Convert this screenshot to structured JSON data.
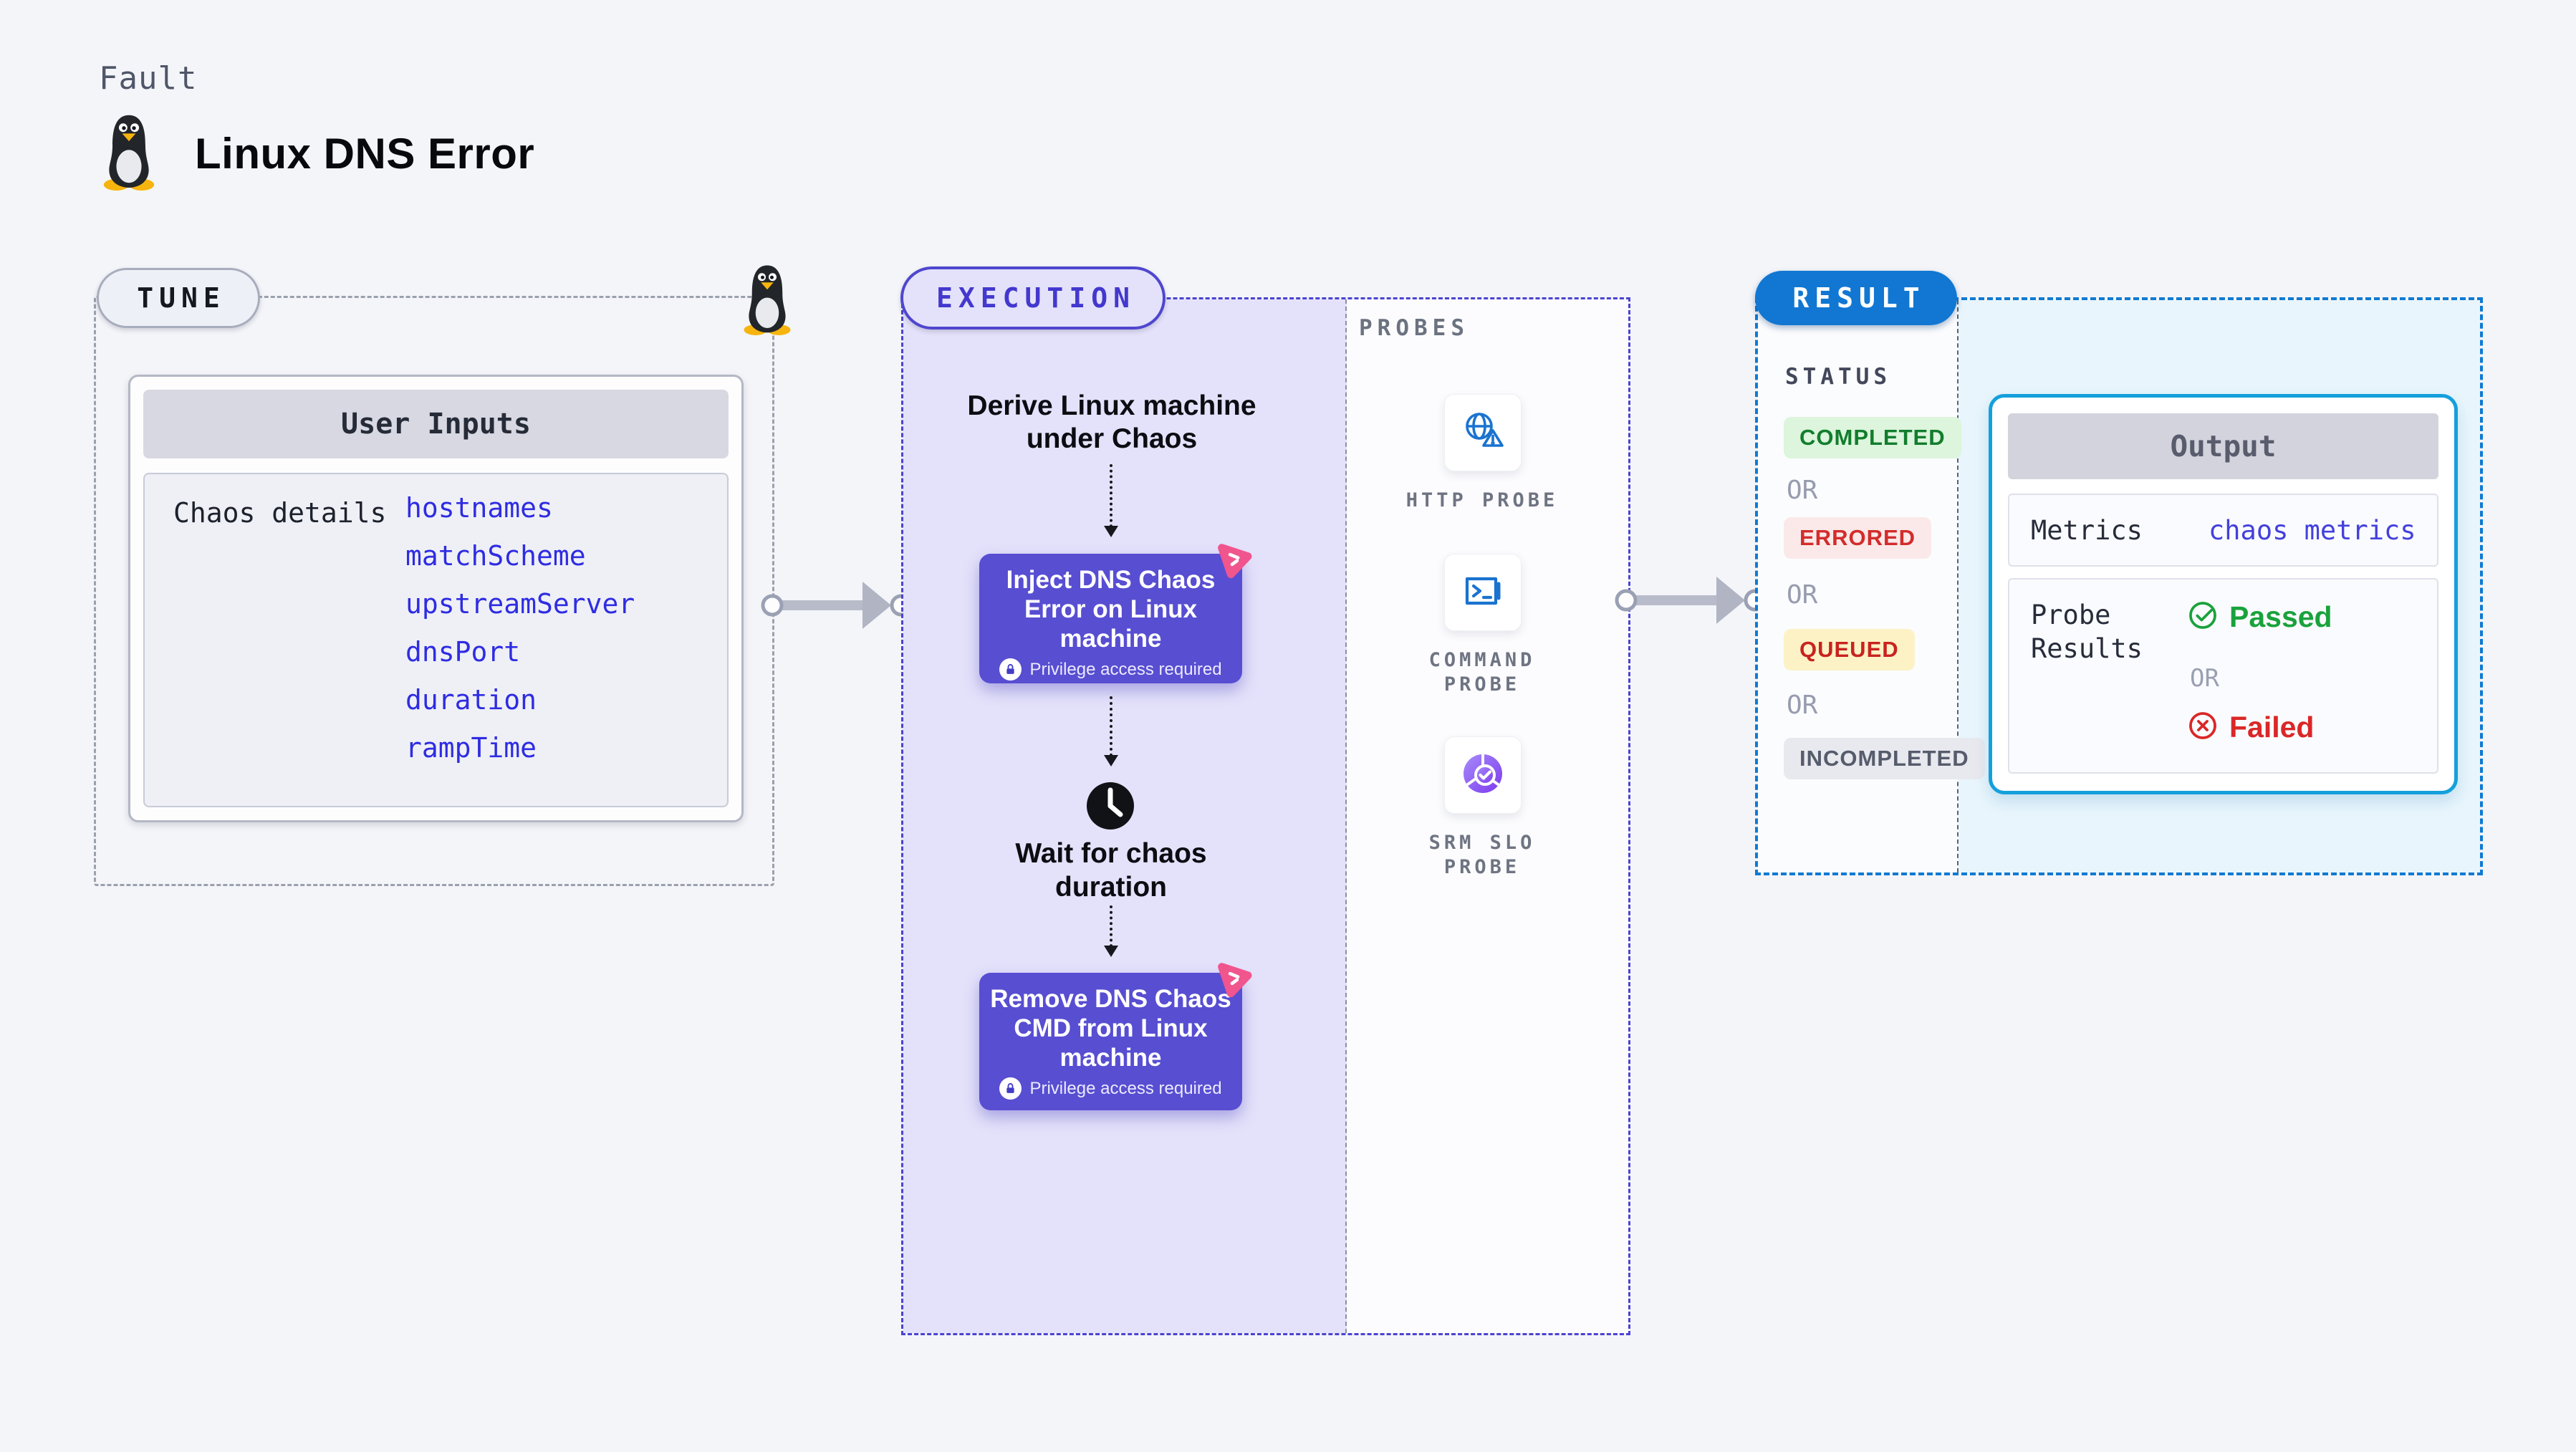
{
  "page": {
    "kicker": "Fault",
    "title": "Linux DNS Error"
  },
  "tune": {
    "label": "TUNE",
    "user_inputs_title": "User Inputs",
    "chaos_details_label": "Chaos details",
    "params": [
      "hostnames",
      "matchScheme",
      "upstreamServer",
      "dnsPort",
      "duration",
      "rampTime"
    ]
  },
  "execution": {
    "label": "EXECUTION",
    "derive_step": "Derive Linux machine under Chaos",
    "inject_step": "Inject DNS Chaos Error on Linux machine",
    "wait_step": "Wait for chaos duration",
    "remove_step": "Remove DNS Chaos CMD from Linux machine",
    "privilege_note": "Privilege access required"
  },
  "probes": {
    "label": "PROBES",
    "items": [
      {
        "label": "HTTP PROBE",
        "icon": "http-globe-alert-icon"
      },
      {
        "label": "COMMAND PROBE",
        "icon": "command-terminal-icon"
      },
      {
        "label": "SRM SLO PROBE",
        "icon": "srm-slo-pie-check-icon"
      }
    ]
  },
  "result": {
    "label": "RESULT",
    "status_title": "STATUS",
    "or": "OR",
    "statuses": [
      {
        "label": "COMPLETED",
        "color": "#127d2d",
        "bg": "#dcf5dc"
      },
      {
        "label": "ERRORED",
        "color": "#d32c2c",
        "bg": "#fbe9e9"
      },
      {
        "label": "QUEUED",
        "color": "#c8231f",
        "bg": "#fcf2c6"
      },
      {
        "label": "INCOMPLETED",
        "color": "#565c6c",
        "bg": "#e8e9ee"
      }
    ],
    "output": {
      "title": "Output",
      "metrics_label": "Metrics",
      "metrics_value": "chaos metrics",
      "probe_results_label": "Probe Results",
      "passed": "Passed",
      "or": "OR",
      "failed": "Failed"
    }
  },
  "colors": {
    "page_background": "#f4f5f9",
    "tune_dash": "#9aa1ad",
    "execution_dash": "#4b43d1",
    "execution_fill": "#e4e2fa",
    "chaos_card": "#584ed2",
    "pink_badge": "#f0558e",
    "probe_icon_blue": "#1a73cf",
    "srm_purple": "#7c3aed",
    "result_dash": "#0f7ad2",
    "result_pill": "#1177d2",
    "output_border": "#14a0dc",
    "param_blue": "#2f2ce2",
    "passed_green": "#1aa23c",
    "failed_red": "#da2727"
  }
}
